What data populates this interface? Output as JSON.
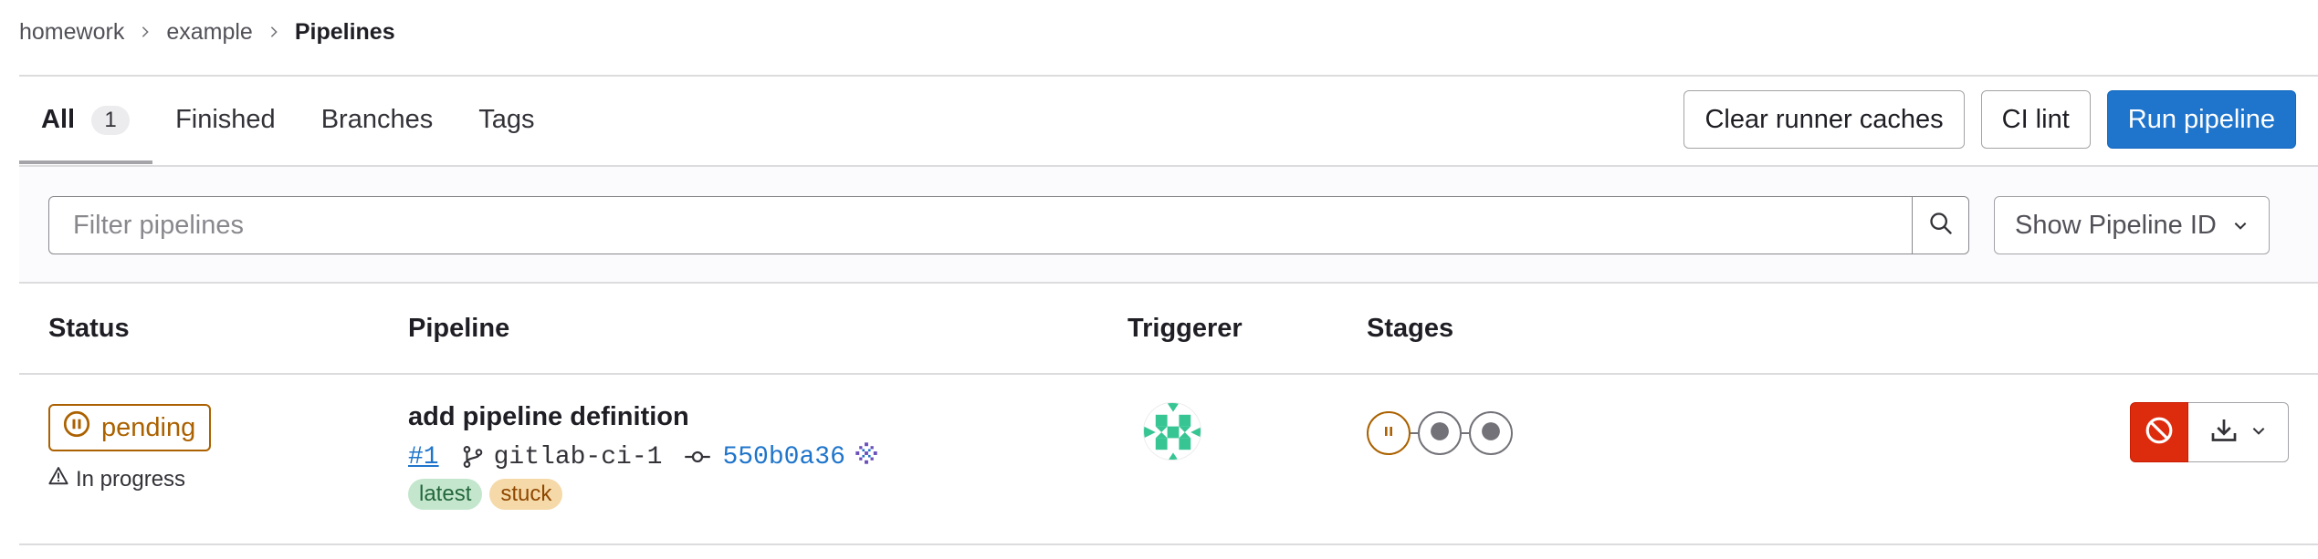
{
  "breadcrumb": {
    "items": [
      "homework",
      "example"
    ],
    "current": "Pipelines"
  },
  "tabs": [
    {
      "label": "All",
      "count": "1",
      "active": true
    },
    {
      "label": "Finished"
    },
    {
      "label": "Branches"
    },
    {
      "label": "Tags"
    }
  ],
  "actions": {
    "clear_caches": "Clear runner caches",
    "ci_lint": "CI lint",
    "run_pipeline": "Run pipeline"
  },
  "filter": {
    "placeholder": "Filter pipelines",
    "select_label": "Show Pipeline ID"
  },
  "table": {
    "headers": {
      "status": "Status",
      "pipeline": "Pipeline",
      "triggerer": "Triggerer",
      "stages": "Stages"
    },
    "rows": [
      {
        "status": "pending",
        "status_detail": "In progress",
        "title": "add pipeline definition",
        "id": "#1",
        "ref": "gitlab-ci-1",
        "sha": "550b0a36",
        "labels": [
          "latest",
          "stuck"
        ],
        "stages": [
          "pending",
          "created",
          "created"
        ]
      }
    ]
  },
  "colors": {
    "primary": "#1f75cb",
    "danger": "#dd2b0e",
    "pending": "#ab6100",
    "latest_bg": "#c3e6cd",
    "stuck_bg": "#f5d9a8"
  },
  "icons": [
    "chevron-right-icon",
    "search-icon",
    "chevron-down-icon",
    "status-pending-icon",
    "warning-icon",
    "branch-icon",
    "commit-icon",
    "commit-signature-icon",
    "cancel-icon",
    "download-icon"
  ]
}
